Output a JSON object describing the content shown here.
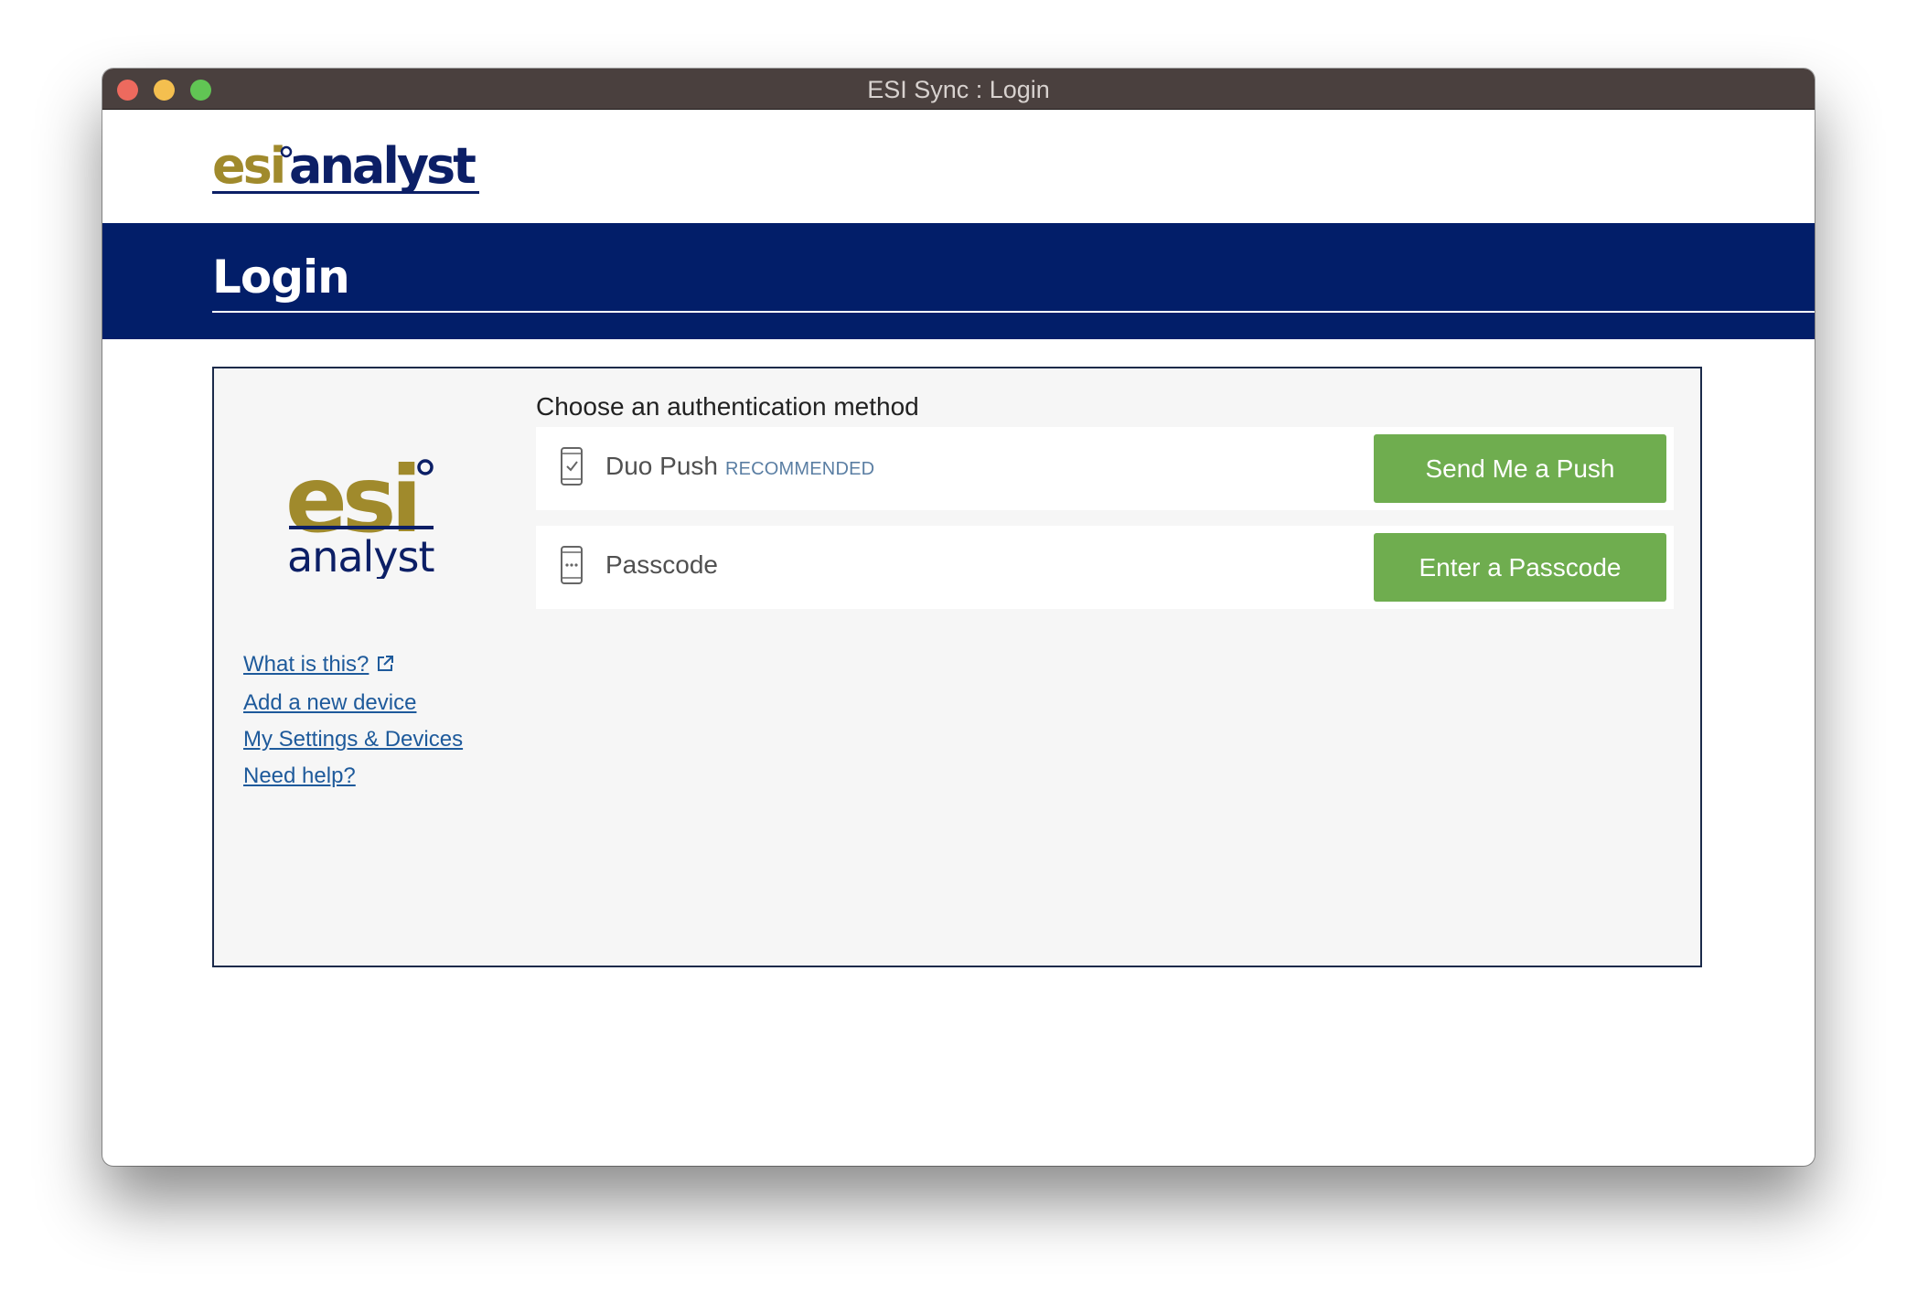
{
  "window": {
    "title": "ESI Sync : Login"
  },
  "header": {
    "logo_text_esi": "esi",
    "logo_text_analyst": "analyst"
  },
  "login_band": {
    "title": "Login"
  },
  "panel": {
    "side_logo_esi": "esi",
    "side_logo_analyst": "analyst",
    "links": [
      {
        "label": "What is this?"
      },
      {
        "label": "Add a new device"
      },
      {
        "label": "My Settings & Devices"
      },
      {
        "label": "Need help?"
      }
    ],
    "heading": "Choose an authentication method",
    "methods": [
      {
        "label": "Duo Push",
        "badge": "RECOMMENDED",
        "button": "Send Me a Push",
        "icon": "phone-check-icon"
      },
      {
        "label": "Passcode",
        "badge": "",
        "button": "Enter a Passcode",
        "icon": "phone-dots-icon"
      }
    ]
  },
  "colors": {
    "brand_gold": "#a08a2c",
    "brand_navy": "#0c1f66",
    "band_navy": "#021e69",
    "button_green": "#6fad4f",
    "link_blue": "#1e5a9b"
  }
}
